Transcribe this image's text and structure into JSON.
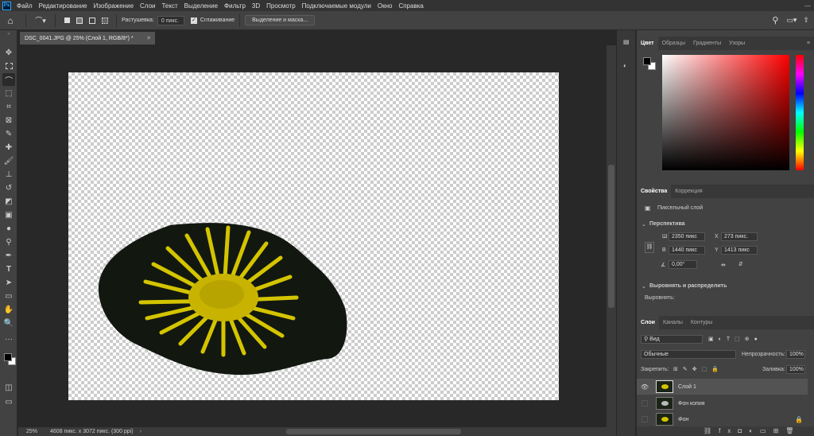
{
  "menu": [
    "Файл",
    "Редактирование",
    "Изображение",
    "Слои",
    "Текст",
    "Выделение",
    "Фильтр",
    "3D",
    "Просмотр",
    "Подключаемые модули",
    "Окно",
    "Справка"
  ],
  "options": {
    "feather_label": "Растушевка:",
    "feather_value": "0 пикс.",
    "antialias_label": "Сглаживание",
    "select_mask_button": "Выделение и маска..."
  },
  "document": {
    "tab_title": "DSC_0041.JPG @ 25% (Слой 1, RGB/8*) *",
    "zoom": "25%",
    "dimensions": "4608 пикс. x 3072 пикс. (300 ppi)"
  },
  "color_panel": {
    "tabs": [
      "Цвет",
      "Образцы",
      "Градиенты",
      "Узоры"
    ],
    "hue_color": "#ff0000"
  },
  "properties_panel": {
    "tabs": [
      "Свойства",
      "Коррекция"
    ],
    "layer_type": "Пиксельный слой",
    "section_transform": "Перспектива",
    "w_label": "Ш",
    "w_value": "2350 пикс",
    "h_label": "В",
    "h_value": "1440 пикс",
    "x_label": "X",
    "x_value": "273 пикс.",
    "y_label": "Y",
    "y_value": "1413 пикс",
    "angle_value": "0,00°",
    "section_align": "Выровнять и распределить",
    "align_label": "Выровнять:"
  },
  "layers_panel": {
    "tabs": [
      "Слои",
      "Каналы",
      "Контуры"
    ],
    "filter_kind": "Вид",
    "blend_mode": "Обычные",
    "opacity_label": "Непрозрачность:",
    "opacity_value": "100%",
    "lock_label": "Закрепить:",
    "fill_label": "Заливка:",
    "fill_value": "100%",
    "layers": [
      {
        "name": "Слой 1",
        "visible": true,
        "selected": true
      },
      {
        "name": "Фон копия",
        "visible": false,
        "selected": false
      },
      {
        "name": "Фон",
        "visible": false,
        "selected": false
      }
    ]
  }
}
